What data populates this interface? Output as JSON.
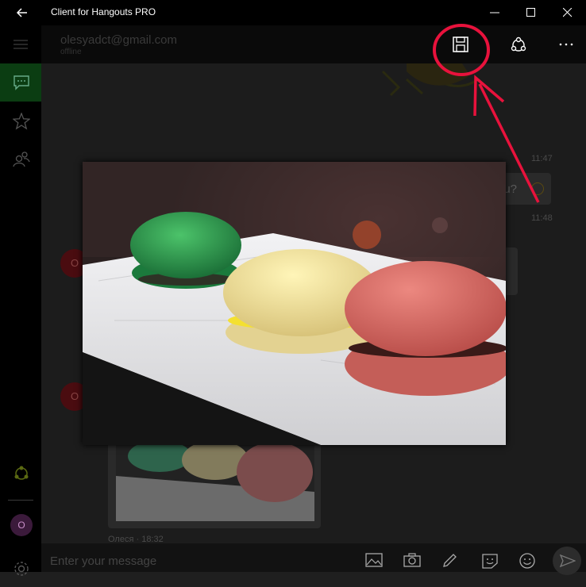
{
  "window": {
    "title": "Client for Hangouts PRO",
    "back_icon": "back-arrow-icon",
    "minimize_icon": "minimize-icon",
    "maximize_icon": "maximize-icon",
    "close_icon": "close-icon"
  },
  "sidebar": {
    "items": [
      {
        "name": "menu",
        "icon": "hamburger-icon"
      },
      {
        "name": "conversations",
        "icon": "chat-icon",
        "active": true
      },
      {
        "name": "favorites",
        "icon": "star-icon"
      },
      {
        "name": "contacts",
        "icon": "contacts-icon"
      },
      {
        "name": "hangouts",
        "icon": "hangouts-icon"
      },
      {
        "name": "account",
        "icon": "avatar"
      },
      {
        "name": "settings",
        "icon": "gear-icon"
      }
    ],
    "avatar_letter": "O"
  },
  "header": {
    "email": "olesyadct@gmail.com",
    "status": "offline",
    "actions": [
      "save-icon",
      "share-icon",
      "more-icon"
    ]
  },
  "chat": {
    "timestamps": [
      "11:47",
      "11:48"
    ],
    "partial_message": "ou? ",
    "sender_avatar_letter": "O",
    "footer_caption": "Олеся  ·  18:32"
  },
  "composer": {
    "placeholder": "Enter your message",
    "icons": [
      "image-icon",
      "camera-icon",
      "pen-icon",
      "sticker-icon",
      "emoji-icon",
      "send-icon"
    ]
  },
  "colors": {
    "titlebar": "#000000",
    "accent_annotation": "#e8123c",
    "active_sidebar": "#0b3d12"
  }
}
